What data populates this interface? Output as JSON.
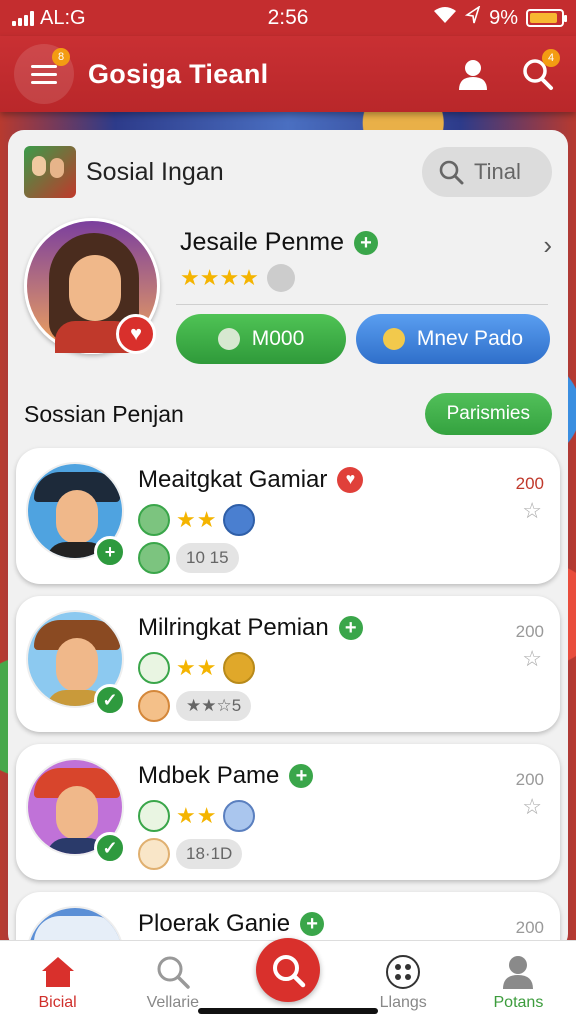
{
  "status_bar": {
    "carrier": "AL:G",
    "time": "2:56",
    "battery_percent": "9%"
  },
  "header": {
    "title": "Gosiga Tieanl",
    "menu_badge": "8",
    "search_badge": "4"
  },
  "card": {
    "title": "Sosial Ingan",
    "search_label": "Tinal"
  },
  "profile": {
    "name": "Jesaile Penme",
    "rating_stars": "★★★★",
    "left_button": "M000",
    "right_button": "Mnev Pado"
  },
  "section": {
    "title": "Sossian Penjan",
    "button": "Parismies"
  },
  "players": [
    {
      "name": "Meaitgkat Gamiar",
      "score": "200",
      "stars": "★★",
      "pill": "10 15",
      "score_color": "#c0392b"
    },
    {
      "name": "Milringkat Pemian",
      "score": "200",
      "stars": "★★",
      "pill": "★★☆5",
      "score_color": "#999999"
    },
    {
      "name": "Mdbek Pame",
      "score": "200",
      "stars": "★★",
      "pill": "18·1D",
      "score_color": "#999999"
    },
    {
      "name": "Ploerak Ganie",
      "score": "200"
    }
  ],
  "bottom_nav": [
    {
      "label": "Bicial",
      "icon": "home-icon"
    },
    {
      "label": "Vellarie",
      "icon": "search-icon"
    },
    {
      "label": "",
      "icon": "search-fab-icon"
    },
    {
      "label": "Llangs",
      "icon": "grid-icon"
    },
    {
      "label": "Potans",
      "icon": "profile-icon"
    }
  ],
  "colors": {
    "brand_red": "#c42d2f",
    "accent_green": "#3aa64a",
    "accent_blue": "#2f6fca",
    "star_gold": "#f4b400"
  }
}
